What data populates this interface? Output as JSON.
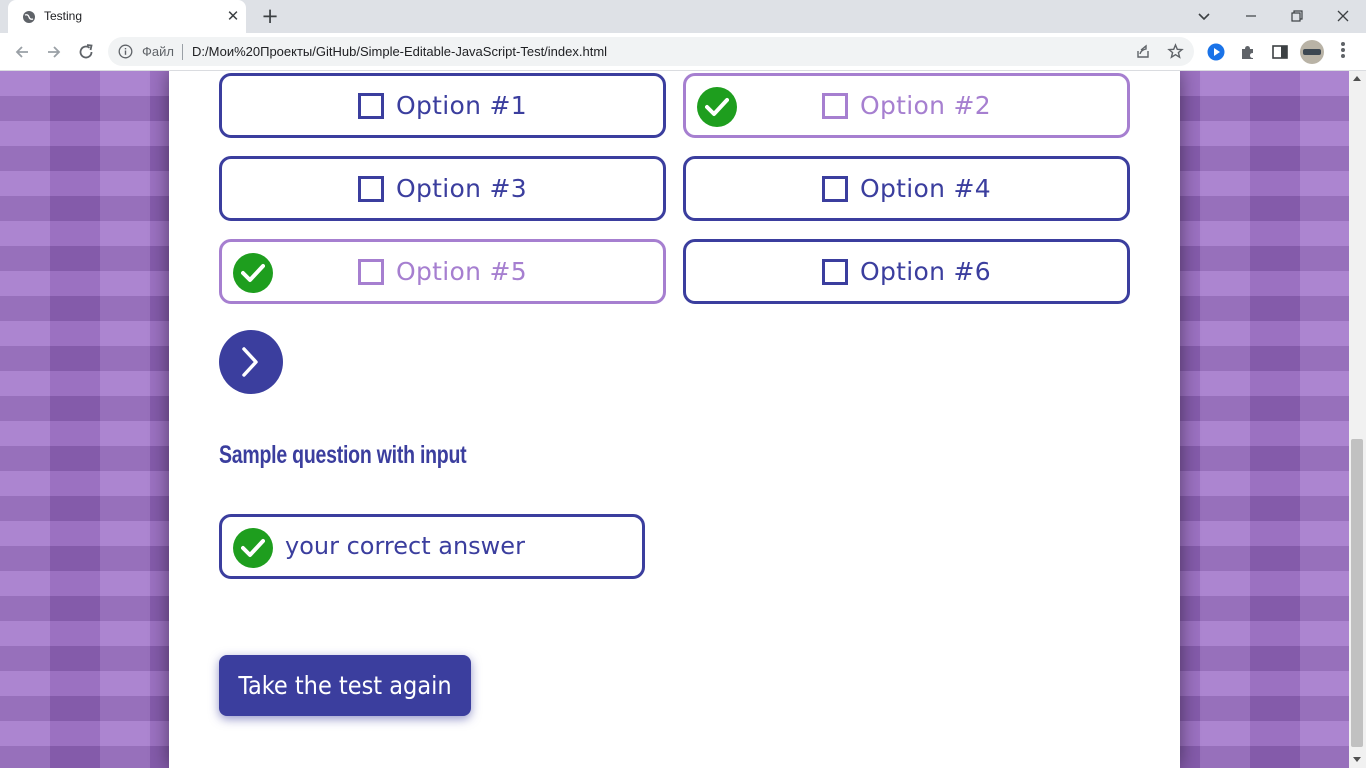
{
  "browser": {
    "tab_title": "Testing",
    "tab_close_glyph": "✕",
    "new_tab_glyph": "+",
    "scheme_label": "Файл",
    "url": "D:/Мои%20Проекты/GitHub/Simple-Editable-JavaScript-Test/index.html",
    "icons": [
      "globe-icon",
      "back-icon",
      "forward-icon",
      "reload-icon",
      "info-icon",
      "share-icon",
      "star-icon",
      "extension-icon",
      "puzzle-icon",
      "sidepanel-icon",
      "avatar",
      "menu-icon",
      "minimize-icon",
      "restore-icon",
      "close-icon",
      "chevron-down-icon"
    ]
  },
  "quiz": {
    "options": [
      {
        "label": "Option #1",
        "state": "default"
      },
      {
        "label": "Option #2",
        "state": "correct"
      },
      {
        "label": "Option #3",
        "state": "default"
      },
      {
        "label": "Option #4",
        "state": "default"
      },
      {
        "label": "Option #5",
        "state": "correct"
      },
      {
        "label": "Option #6",
        "state": "default"
      }
    ],
    "question_title": "Sample question with input",
    "answer_value": "your correct answer",
    "retake_label": "Take the test again"
  },
  "colors": {
    "accent": "#3b3e9e",
    "correct_border": "#a67fd0",
    "check_green": "#1e9e1e",
    "background_purple": "#9b6bc7"
  }
}
